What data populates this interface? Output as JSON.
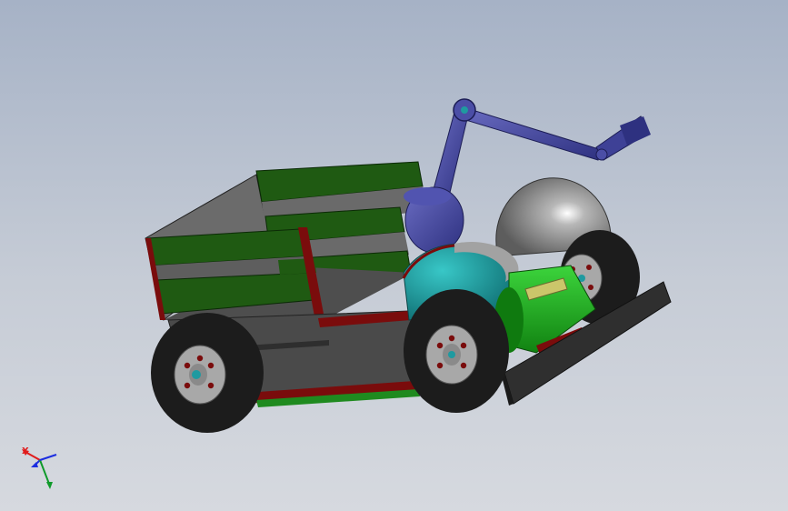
{
  "viewport": {
    "background_top": "#a6b2c6",
    "background_bottom": "#d6d9df"
  },
  "model": {
    "description_icon": "robot-cart-model",
    "colors": {
      "chassis": "#5a5a5a",
      "chassis_dark": "#3e3e3e",
      "slats": "#1f5a12",
      "trim": "#7a0c0c",
      "tire": "#1c1c1c",
      "hub": "#a8a8a8",
      "arm": "#3e4196",
      "teal_shell": "#1f9aa0",
      "motor": "#22b522",
      "dome": "#8c8c8c"
    }
  },
  "triad": {
    "x_label": "X",
    "x_color": "#e01c1c",
    "y_color": "#0f9a2a",
    "z_color": "#1c2ee0"
  }
}
